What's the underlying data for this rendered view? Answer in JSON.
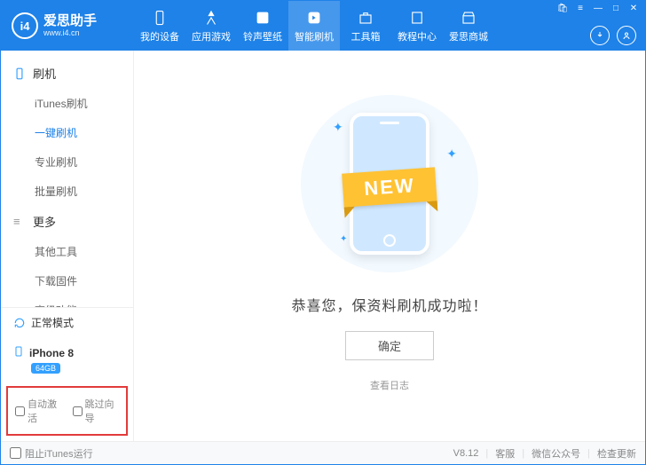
{
  "app": {
    "logo_text": "i4",
    "name": "爱思助手",
    "site": "www.i4.cn"
  },
  "nav": [
    {
      "label": "我的设备"
    },
    {
      "label": "应用游戏"
    },
    {
      "label": "铃声壁纸"
    },
    {
      "label": "智能刷机",
      "active": true
    },
    {
      "label": "工具箱"
    },
    {
      "label": "教程中心"
    },
    {
      "label": "爱思商城"
    }
  ],
  "sidebar": {
    "groups": [
      {
        "title": "刷机",
        "items": [
          {
            "label": "iTunes刷机"
          },
          {
            "label": "一键刷机",
            "active": true
          },
          {
            "label": "专业刷机"
          },
          {
            "label": "批量刷机"
          }
        ]
      },
      {
        "title": "更多",
        "items": [
          {
            "label": "其他工具"
          },
          {
            "label": "下载固件"
          },
          {
            "label": "高级功能"
          }
        ]
      }
    ],
    "status": "正常模式",
    "device": {
      "name": "iPhone 8",
      "capacity": "64GB"
    },
    "options": {
      "auto_activate": "自动激活",
      "skip_guide": "跳过向导"
    }
  },
  "main": {
    "ribbon": "NEW",
    "message": "恭喜您，保资料刷机成功啦！",
    "confirm": "确定",
    "view_log": "查看日志"
  },
  "footer": {
    "block_itunes": "阻止iTunes运行",
    "version": "V8.12",
    "service": "客服",
    "wechat": "微信公众号",
    "update": "检查更新"
  }
}
